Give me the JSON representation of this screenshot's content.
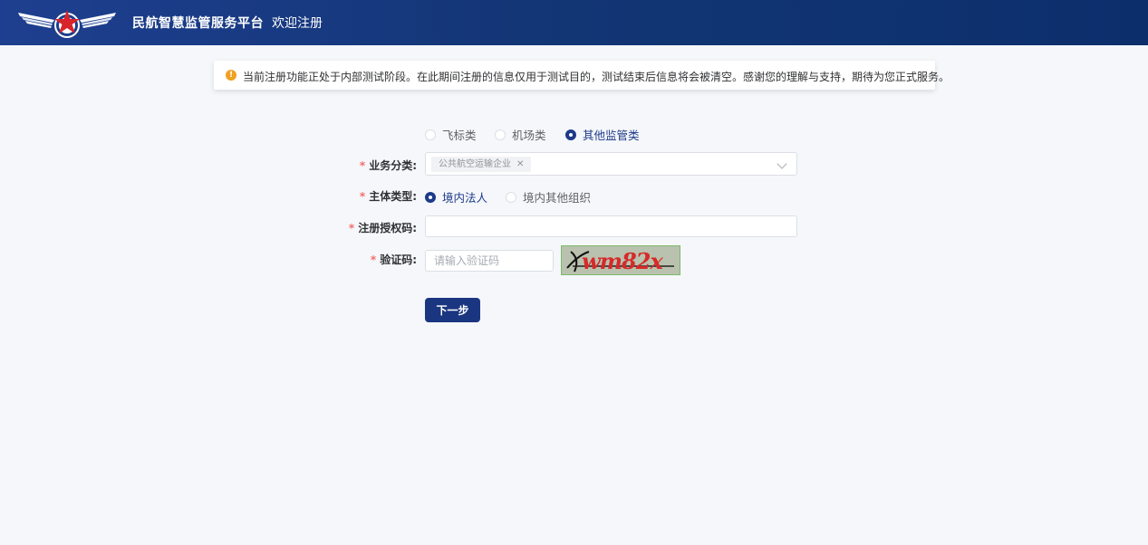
{
  "header": {
    "brand": "民航智慧监管服务平台",
    "welcome": "欢迎注册"
  },
  "notice": {
    "text": "当前注册功能正处于内部测试阶段。在此期间注册的信息仅用于测试目的，测试结束后信息将会被清空。感谢您的理解与支持，期待为您正式服务。"
  },
  "category": {
    "options": [
      "飞标类",
      "机场类",
      "其他监管类"
    ],
    "selected": "其他监管类"
  },
  "form": {
    "business": {
      "label": "业务分类:",
      "tag": "公共航空运输企业"
    },
    "entity": {
      "label": "主体类型:",
      "options": [
        "境内法人",
        "境内其他组织"
      ],
      "selected": "境内法人"
    },
    "auth": {
      "label": "注册授权码:",
      "value": ""
    },
    "captcha": {
      "label": "验证码:",
      "placeholder": "请输入验证码",
      "image_text": "wm82x"
    },
    "next_label": "下一步"
  },
  "colors": {
    "header": "#123574",
    "primary": "#1a3680",
    "required": "#f56c6c",
    "warning": "#f0a020"
  }
}
